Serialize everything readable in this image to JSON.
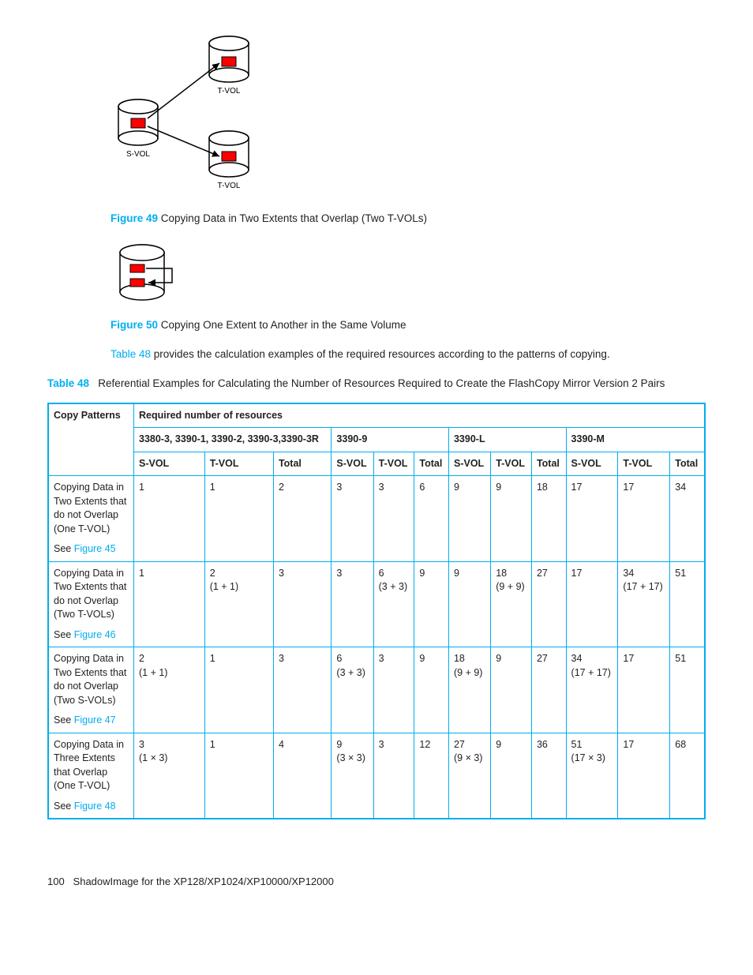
{
  "figure49": {
    "svol_label": "S-VOL",
    "tvol_top_label": "T-VOL",
    "tvol_bottom_label": "T-VOL",
    "caption_label": "Figure 49",
    "caption_text": "Copying Data in Two Extents that Overlap (Two T-VOLs)"
  },
  "figure50": {
    "caption_label": "Figure 50",
    "caption_text": "Copying One Extent to Another in the Same Volume"
  },
  "intro_para": {
    "link_text": "Table 48",
    "rest": " provides the calculation examples of the required resources according to the patterns of copying."
  },
  "table_caption": {
    "label": "Table 48",
    "text": "Referential Examples for Calculating the Number of Resources Required to Create the FlashCopy Mirror Version 2 Pairs"
  },
  "table_headers": {
    "copy_patterns": "Copy Patterns",
    "required": "Required number of resources",
    "group_a": "3380-3, 3390-1, 3390-2, 3390-3,3390-3R",
    "group_b": "3390-9",
    "group_c": "3390-L",
    "group_d": "3390-M",
    "svol": "S-VOL",
    "tvol": "T-VOL",
    "total": "Total"
  },
  "rows": [
    {
      "desc": "Copying Data in Two Extents that do not Overlap (One T-VOL)",
      "see_prefix": "See ",
      "see_link": "Figure 45",
      "a_s": "1",
      "a_t": "1",
      "a_tot": "2",
      "b_s": "3",
      "b_t": "3",
      "b_tot": "6",
      "c_s": "9",
      "c_t": "9",
      "c_tot": "18",
      "d_s": "17",
      "d_t": "17",
      "d_tot": "34"
    },
    {
      "desc": "Copying Data in Two Extents that do not Overlap (Two T-VOLs)",
      "see_prefix": "See ",
      "see_link": "Figure 46",
      "a_s": "1",
      "a_t": "2\n(1 + 1)",
      "a_tot": "3",
      "b_s": "3",
      "b_t": "6\n(3 + 3)",
      "b_tot": "9",
      "c_s": "9",
      "c_t": "18\n(9 + 9)",
      "c_tot": "27",
      "d_s": "17",
      "d_t": "34\n(17 + 17)",
      "d_tot": "51"
    },
    {
      "desc": "Copying Data in Two Extents that do not Overlap (Two S-VOLs)",
      "see_prefix": "See ",
      "see_link": "Figure 47",
      "a_s": "2\n(1 + 1)",
      "a_t": "1",
      "a_tot": "3",
      "b_s": "6\n(3 + 3)",
      "b_t": "3",
      "b_tot": "9",
      "c_s": "18\n(9 + 9)",
      "c_t": "9",
      "c_tot": "27",
      "d_s": "34\n(17 + 17)",
      "d_t": "17",
      "d_tot": "51"
    },
    {
      "desc": "Copying Data in Three Extents that Overlap (One T-VOL)",
      "see_prefix": "See ",
      "see_link": "Figure 48",
      "a_s": "3\n(1 × 3)",
      "a_t": "1",
      "a_tot": "4",
      "b_s": "9\n(3 × 3)",
      "b_t": "3",
      "b_tot": "12",
      "c_s": "27\n(9 × 3)",
      "c_t": "9",
      "c_tot": "36",
      "d_s": "51\n(17 × 3)",
      "d_t": "17",
      "d_tot": "68"
    }
  ],
  "footer": {
    "page": "100",
    "title": "ShadowImage for the XP128/XP1024/XP10000/XP12000"
  },
  "chart_data": {
    "type": "table",
    "title": "Referential Examples for Calculating the Number of Resources Required to Create the FlashCopy Mirror Version 2 Pairs",
    "column_groups": [
      "3380-3, 3390-1, 3390-2, 3390-3,3390-3R",
      "3390-9",
      "3390-L",
      "3390-M"
    ],
    "sub_columns": [
      "S-VOL",
      "T-VOL",
      "Total"
    ],
    "rows": [
      {
        "pattern": "Copying Data in Two Extents that do not Overlap (One T-VOL) — See Figure 45",
        "values": {
          "3380-3/3390-1/3390-2/3390-3/3390-3R": {
            "S-VOL": 1,
            "T-VOL": 1,
            "Total": 2
          },
          "3390-9": {
            "S-VOL": 3,
            "T-VOL": 3,
            "Total": 6
          },
          "3390-L": {
            "S-VOL": 9,
            "T-VOL": 9,
            "Total": 18
          },
          "3390-M": {
            "S-VOL": 17,
            "T-VOL": 17,
            "Total": 34
          }
        }
      },
      {
        "pattern": "Copying Data in Two Extents that do not Overlap (Two T-VOLs) — See Figure 46",
        "values": {
          "3380-3/3390-1/3390-2/3390-3/3390-3R": {
            "S-VOL": 1,
            "T-VOL": 2,
            "T-VOL_expr": "1 + 1",
            "Total": 3
          },
          "3390-9": {
            "S-VOL": 3,
            "T-VOL": 6,
            "T-VOL_expr": "3 + 3",
            "Total": 9
          },
          "3390-L": {
            "S-VOL": 9,
            "T-VOL": 18,
            "T-VOL_expr": "9 + 9",
            "Total": 27
          },
          "3390-M": {
            "S-VOL": 17,
            "T-VOL": 34,
            "T-VOL_expr": "17 + 17",
            "Total": 51
          }
        }
      },
      {
        "pattern": "Copying Data in Two Extents that do not Overlap (Two S-VOLs) — See Figure 47",
        "values": {
          "3380-3/3390-1/3390-2/3390-3/3390-3R": {
            "S-VOL": 2,
            "S-VOL_expr": "1 + 1",
            "T-VOL": 1,
            "Total": 3
          },
          "3390-9": {
            "S-VOL": 6,
            "S-VOL_expr": "3 + 3",
            "T-VOL": 3,
            "Total": 9
          },
          "3390-L": {
            "S-VOL": 18,
            "S-VOL_expr": "9 + 9",
            "T-VOL": 9,
            "Total": 27
          },
          "3390-M": {
            "S-VOL": 34,
            "S-VOL_expr": "17 + 17",
            "T-VOL": 17,
            "Total": 51
          }
        }
      },
      {
        "pattern": "Copying Data in Three Extents that Overlap (One T-VOL) — See Figure 48",
        "values": {
          "3380-3/3390-1/3390-2/3390-3/3390-3R": {
            "S-VOL": 3,
            "S-VOL_expr": "1 × 3",
            "T-VOL": 1,
            "Total": 4
          },
          "3390-9": {
            "S-VOL": 9,
            "S-VOL_expr": "3 × 3",
            "T-VOL": 3,
            "Total": 12
          },
          "3390-L": {
            "S-VOL": 27,
            "S-VOL_expr": "9 × 3",
            "T-VOL": 9,
            "Total": 36
          },
          "3390-M": {
            "S-VOL": 51,
            "S-VOL_expr": "17 × 3",
            "T-VOL": 17,
            "Total": 68
          }
        }
      }
    ]
  }
}
